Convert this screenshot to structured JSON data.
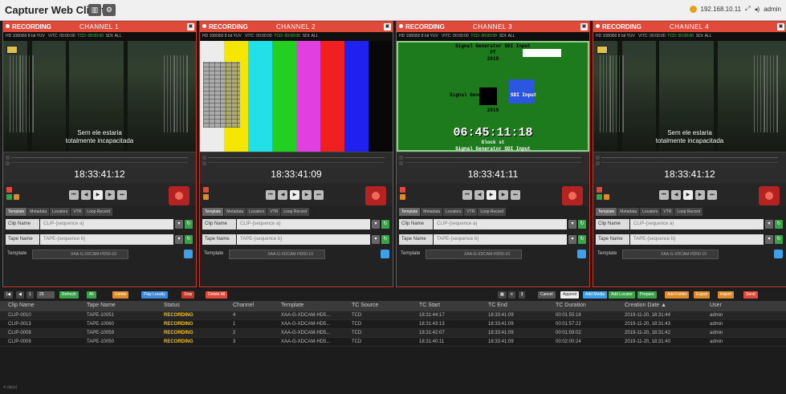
{
  "app": {
    "title": "Capturer Web Client",
    "user_info": "192.168.10.11",
    "admin": "admin"
  },
  "channels": [
    {
      "status": "RECORDING",
      "name": "CHANNEL 1",
      "info_left": "HD 1080i50 8 bit YUV",
      "info_mid": "VITC: 00:00:00",
      "info_tc": "TCD: 00:00:00",
      "info_right": "SDI: ALL",
      "timecode": "18:33:41:12",
      "subtitle_line1": "Sem ele estaria",
      "subtitle_line2": "totalmente incapacitada",
      "clip_placeholder": "CLIP-{sequence a}",
      "tape_placeholder": "TAPE-{sequence b}",
      "template_value": "XAA-G-XDCAM-HD50-10"
    },
    {
      "status": "RECORDING",
      "name": "CHANNEL 2",
      "info_left": "HD 1080i50 8 bit YUV",
      "info_mid": "VITC: 00:00:00",
      "info_tc": "TCD: 00:00:00",
      "info_right": "SDI: ALL",
      "timecode": "18:33:41:09",
      "clip_placeholder": "CLIP-{sequence a}",
      "tape_placeholder": "TAPE-{sequence b}",
      "template_value": "XAA-G-XDCAM HD50-10"
    },
    {
      "status": "RECORDING",
      "name": "CHANNEL 3",
      "info_left": "HD 1080i50 8 bit YUV",
      "info_mid": "VITC: 00:00:00",
      "info_tc": "TCD: 00:00:00",
      "info_right": "SDI: ALL",
      "timecode": "18:33:41:11",
      "gen_title": "Signal Generator SDI Input",
      "gen_pt": "PT",
      "gen_year": "2019",
      "gen_mid_left": "Signal Generator",
      "gen_mid_right": "SDI Input",
      "gen_tc": "06:45:11:18",
      "gen_glock": "Glock st",
      "gen_bottom": "Signal Generator SDI Input",
      "clip_placeholder": "CLIP-{sequence a}",
      "tape_placeholder": "TAPE-{sequence b}",
      "template_value": "XAA-G-XDCAM-HD50-10"
    },
    {
      "status": "RECORDING",
      "name": "CHANNEL 4",
      "info_left": "HD 1080i50 8 bit YUV",
      "info_mid": "VITC: 00:00:00",
      "info_tc": "TCD: 00:00:00",
      "info_right": "SDI: ALL",
      "timecode": "18:33:41:12",
      "subtitle_line1": "Sem ele estaria",
      "subtitle_line2": "totalmente incapacitada",
      "clip_placeholder": "CLIP-{sequence a}",
      "tape_placeholder": "TAPE-{sequence b}",
      "template_value": "XAA-G-XDCAM-HD50-10"
    }
  ],
  "panel": {
    "tabs": [
      "Template",
      "Metadata",
      "Locators",
      "VTR",
      "Loop Record"
    ],
    "clip_label": "Clip Name",
    "tape_label": "Tape Name",
    "template_label": "Template"
  },
  "list_toolbar": {
    "left": [
      "25",
      "Refresh",
      "All",
      "Delete",
      "Play Locally",
      "Stop",
      "Delete All"
    ],
    "right": [
      "Cancel",
      "Append",
      "Add Media",
      "Add Locator",
      "Prepare",
      "Add Folder",
      "Export",
      "Import",
      "Send"
    ]
  },
  "table": {
    "headers": [
      "Clip Name",
      "Tape Name",
      "Status",
      "Channel",
      "Template",
      "TC Source",
      "TC Start",
      "TC End",
      "TC Duration",
      "Creation Date ▲",
      "User"
    ],
    "rows": [
      [
        "CLIP-0010",
        "TAPE-10051",
        "RECORDING",
        "4",
        "XAA-G-XDCAM-HD5...",
        "TCD",
        "18:31:44:17",
        "18:33:41:09",
        "00:01:55:18",
        "2019-11-20, 18:31:44",
        "admin"
      ],
      [
        "CLIP-0013",
        "TAPE-10060",
        "RECORDING",
        "1",
        "XAA-G-XDCAM-HD5...",
        "TCD",
        "18:31:43:13",
        "18:33:41:09",
        "00:01:57:22",
        "2019-11-20, 18:31:43",
        "admin"
      ],
      [
        "CLIP-0008",
        "TAPE-10059",
        "RECORDING",
        "2",
        "XAA-G-XDCAM-HD5...",
        "TCD",
        "18:31:42:07",
        "18:33:41:09",
        "00:01:59:02",
        "2019-11-20, 18:31:42",
        "admin"
      ],
      [
        "CLIP-0009",
        "TAPE-10050",
        "RECORDING",
        "3",
        "XAA-G-XDCAM-HD5...",
        "TCD",
        "18:31:40:11",
        "18:33:41:09",
        "00:02:00:24",
        "2019-11-20, 18:31:40",
        "admin"
      ]
    ]
  },
  "footer": "4 clip(s)",
  "colors": {
    "recording_bar": "#e04a3a",
    "accent_blue": "#3ea0e8",
    "status_yellow": "#f0c020",
    "record_red": "#b52222"
  }
}
